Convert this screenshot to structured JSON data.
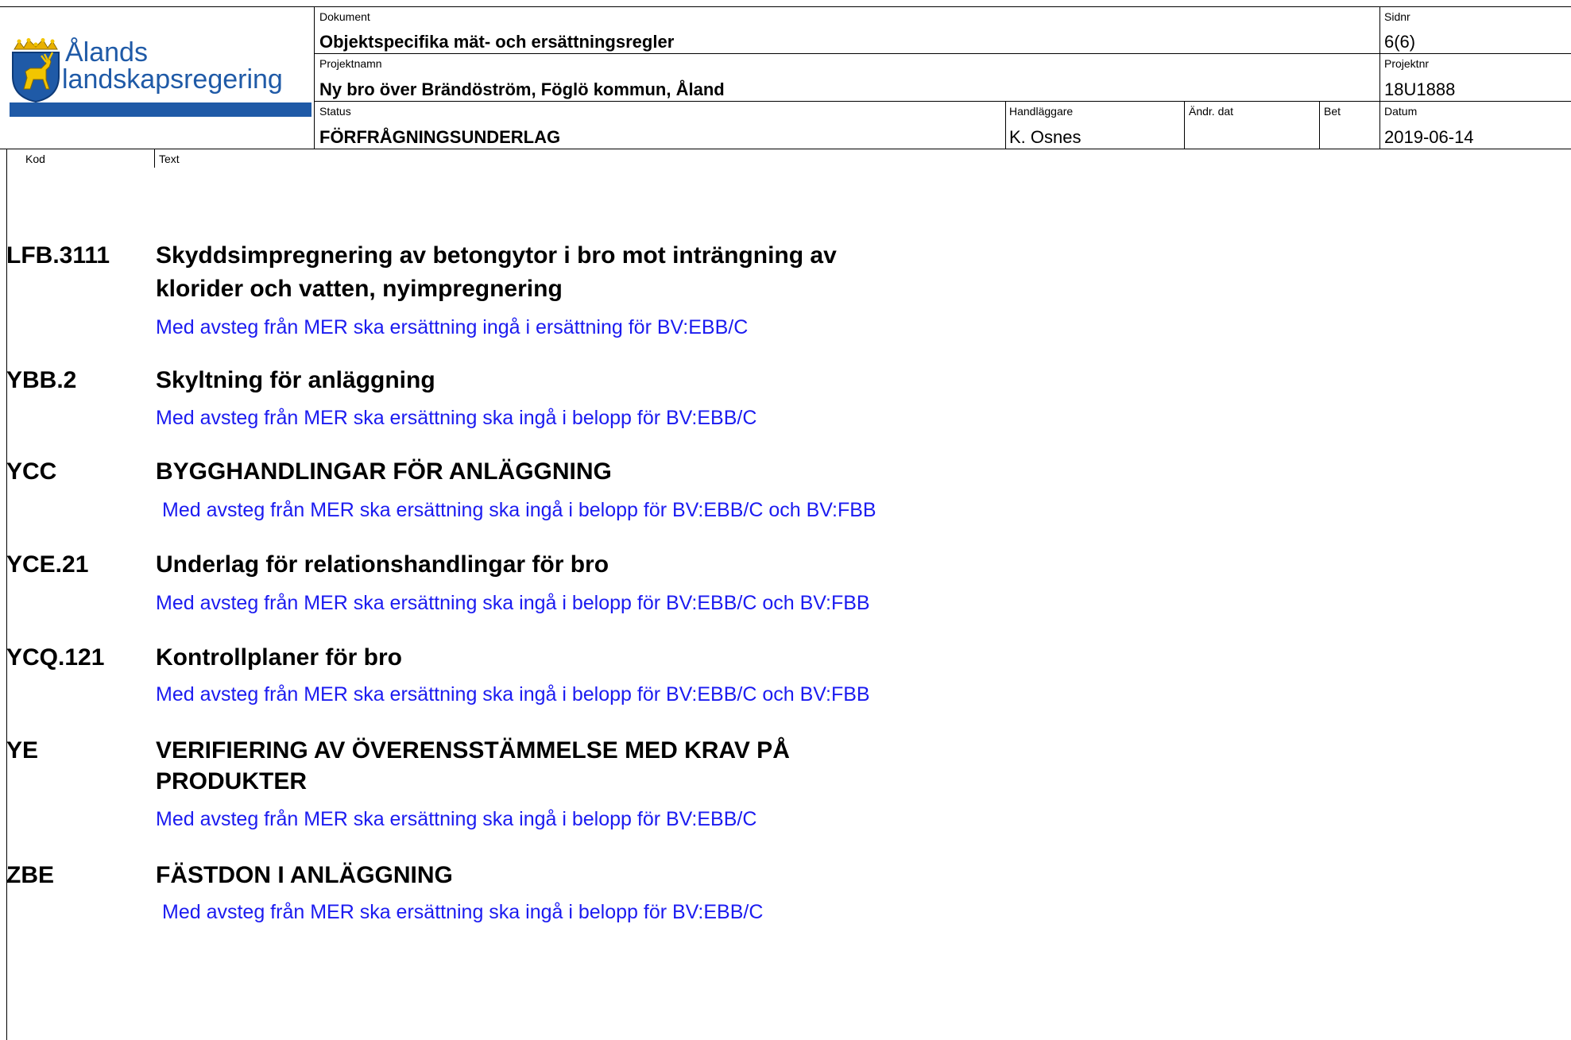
{
  "logo": {
    "line1": "Ålands",
    "line2": "landskapsregering",
    "colors": {
      "blue": "#1f5aa7",
      "gold": "#f2c500",
      "crown": "#e8b000"
    },
    "emblem": "coat-of-arms-deer"
  },
  "header": {
    "dokument_label": "Dokument",
    "dokument_value": "Objektspecifika mät- och ersättningsregler",
    "sidnr_label": "Sidnr",
    "sidnr_value": "6(6)",
    "projektnamn_label": "Projektnamn",
    "projektnamn_value": "Ny bro över Brändöström, Föglö kommun, Åland",
    "projektnr_label": "Projektnr",
    "projektnr_value": "18U1888",
    "status_label": "Status",
    "status_value": "FÖRFRÅGNINGSUNDERLAG",
    "handlaggare_label": "Handläggare",
    "handlaggare_value": "K. Osnes",
    "andr_dat_label": "Ändr. dat",
    "andr_dat_value": "",
    "bet_label": "Bet",
    "bet_value": "",
    "datum_label": "Datum",
    "datum_value": "2019-06-14"
  },
  "columns": {
    "kod": "Kod",
    "text": "Text"
  },
  "text_color": "#1b1bf0",
  "entries": [
    {
      "code": "LFB.3111",
      "heading_line1": "Skyddsimpregnering av betongytor i bro mot inträngning av",
      "heading_line2": "klorider och vatten, nyimpregnering",
      "text": "Med avsteg från MER ska ersättning ingå i ersättning för BV:EBB/C"
    },
    {
      "code": "YBB.2",
      "heading_line1": "Skyltning för anläggning",
      "text": "Med avsteg från MER ska ersättning ska ingå i belopp för BV:EBB/C"
    },
    {
      "code": "YCC",
      "heading_line1": "BYGGHANDLINGAR FÖR ANLÄGGNING",
      "text": "Med avsteg från MER ska ersättning ska ingå i belopp för BV:EBB/C och BV:FBB"
    },
    {
      "code": "YCE.21",
      "heading_line1": "Underlag för relationshandlingar för bro",
      "text": "Med avsteg från MER ska ersättning ska ingå i belopp för BV:EBB/C och BV:FBB"
    },
    {
      "code": "YCQ.121",
      "heading_line1": "Kontrollplaner för bro",
      "text": "Med avsteg från MER ska ersättning ska ingå i belopp för BV:EBB/C och BV:FBB"
    },
    {
      "code": "YE",
      "heading_line1": "VERIFIERING AV ÖVERENSSTÄMMELSE MED KRAV PÅ",
      "heading_line2": "PRODUKTER",
      "text": "Med avsteg från MER ska ersättning ska ingå i belopp för BV:EBB/C"
    },
    {
      "code": "ZBE",
      "heading_line1": "FÄSTDON I ANLÄGGNING",
      "text": "Med avsteg från MER ska ersättning ska ingå i belopp för BV:EBB/C"
    }
  ]
}
